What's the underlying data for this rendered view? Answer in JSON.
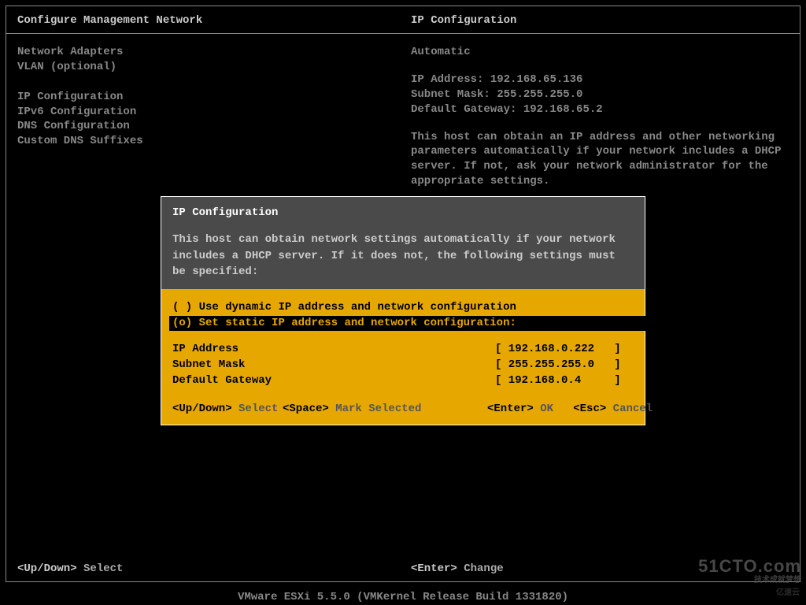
{
  "header": {
    "left_title": "Configure Management Network",
    "right_title": "IP Configuration"
  },
  "menu": {
    "items": [
      "Network Adapters",
      "VLAN (optional)",
      "",
      "IP Configuration",
      "IPv6 Configuration",
      "DNS Configuration",
      "Custom DNS Suffixes"
    ]
  },
  "info": {
    "mode": "Automatic",
    "ip_label": "IP Address:",
    "ip_value": "192.168.65.136",
    "mask_label": "Subnet Mask:",
    "mask_value": "255.255.255.0",
    "gw_label": "Default Gateway:",
    "gw_value": "192.168.65.2",
    "help": "This host can obtain an IP address and other networking parameters automatically if your network includes a DHCP server. If not, ask your network administrator for the appropriate settings."
  },
  "footer": {
    "updown_key": "<Up/Down>",
    "updown_action": "Select",
    "enter_key": "<Enter>",
    "enter_action": "Change"
  },
  "bottom_bar": "VMware ESXi 5.5.0 (VMKernel Release Build 1331820)",
  "dialog": {
    "title": "IP Configuration",
    "desc": "This host can obtain network settings automatically if your network includes a DHCP server. If it does not, the following settings must be specified:",
    "options": [
      {
        "marker": "( )",
        "label": "Use dynamic IP address and network configuration",
        "selected": false
      },
      {
        "marker": "(o)",
        "label": "Set static IP address and network configuration:",
        "selected": true
      }
    ],
    "fields": [
      {
        "label": "IP Address",
        "value": "[ 192.168.0.222   ]"
      },
      {
        "label": "Subnet Mask",
        "value": "[ 255.255.255.0   ]"
      },
      {
        "label": "Default Gateway",
        "value": "[ 192.168.0.4     ]"
      }
    ],
    "hints": {
      "updown_key": "<Up/Down>",
      "updown_action": "Select",
      "space_key": "<Space>",
      "space_action": "Mark Selected",
      "enter_key": "<Enter>",
      "enter_action": "OK",
      "esc_key": "<Esc>",
      "esc_action": "Cancel"
    }
  },
  "watermark": {
    "line1": "51CTO.com",
    "line2": "技术成就梦想",
    "line3": "亿速云"
  }
}
